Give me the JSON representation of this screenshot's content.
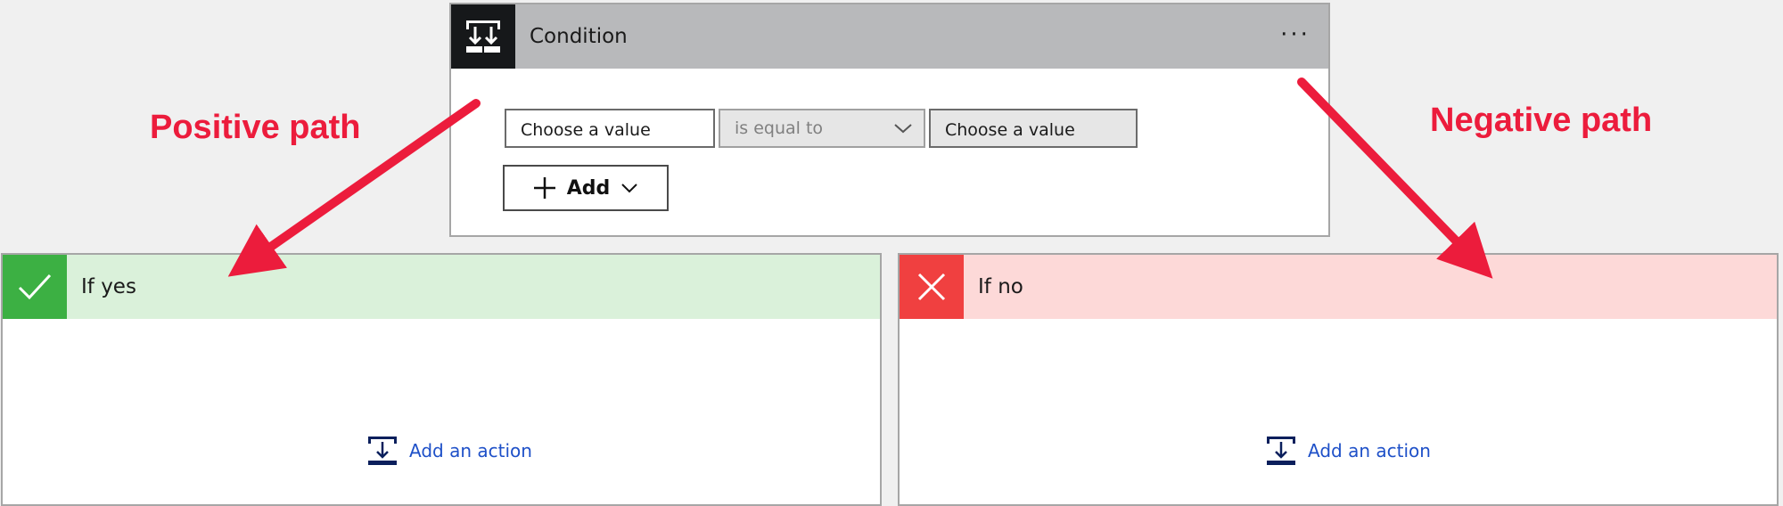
{
  "condition": {
    "title": "Condition",
    "icon": "condition-icon",
    "more_label": "···",
    "left_value_placeholder": "Choose a value",
    "operator": "is equal to",
    "right_value_placeholder": "Choose a value",
    "add_label": "Add"
  },
  "branches": {
    "yes": {
      "title": "If yes",
      "icon": "check-icon",
      "add_action_label": "Add an action",
      "color": "#3cb043",
      "header_color": "#daf1da"
    },
    "no": {
      "title": "If no",
      "icon": "close-icon",
      "add_action_label": "Add an action",
      "color": "#f04040",
      "header_color": "#fdd9d8"
    }
  },
  "annotations": {
    "positive": "Positive path",
    "negative": "Negative path",
    "color": "#ec1c3c"
  }
}
